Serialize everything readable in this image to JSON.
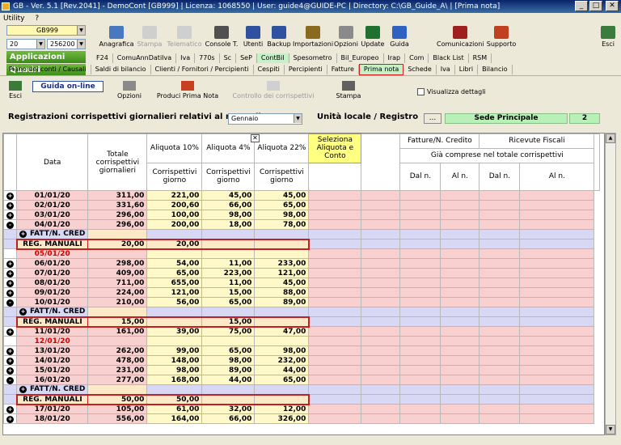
{
  "window": {
    "title": "GB - Ver. 5.1 [Rev.2041] - DemoCont [GB999]   | Licenza: 1068550 | User: guide4@GUIDE-PC | Directory: C:\\GB_Guide_A\\ | [Prima nota]"
  },
  "menu": [
    "Utility",
    "?"
  ],
  "left": {
    "company": "GB999",
    "year": "20",
    "code": "256200",
    "applicazioni": "Applicazioni",
    "quadri": "Quadri"
  },
  "toolbar": [
    "Anagrafica",
    "Stampa",
    "Telematico",
    "Console T.",
    "Utenti",
    "Backup",
    "Importazioni",
    "Opzioni",
    "Update",
    "Guida",
    "Comunicazioni",
    "Supporto",
    "Esci"
  ],
  "tabs1": [
    "F24",
    "ComuAnnDatiIva",
    "Iva",
    "770s",
    "Sc",
    "SeP",
    "ContBil",
    "Spesometro",
    "Bil_Europeo",
    "Irap",
    "Com",
    "Black List",
    "RSM"
  ],
  "tabs2": [
    "Prima nota",
    "Schede",
    "Iva",
    "Libri",
    "Bilancio"
  ],
  "tabs2_left": [
    "Piano dei conti / Causali",
    "Saldi di bilancio",
    "Clienti / Fornitori / Percipienti",
    "Cespiti",
    "Percipienti",
    "Fatture"
  ],
  "sub": {
    "esci": "Esci",
    "guida": "Guida on-line",
    "opzioni": "Opzioni",
    "produci": "Produci Prima Nota",
    "controllo": "Controllo dei corrispettivi",
    "stampa": "Stampa",
    "visualizza": "Visualizza dettagli"
  },
  "form": {
    "title": "Registrazioni corrispettivi giornalieri relativi al mese di",
    "mese": "Gennaio",
    "unita": "Unità locale / Registro",
    "dots": "...",
    "sede": "Sede Principale",
    "num": "2"
  },
  "headers": {
    "data": "Data",
    "totale": "Totale corrispettivi giornalieri",
    "a10": "Aliquota 10%",
    "a4": "Aliquota 4%",
    "a22": "Aliquota 22%",
    "seleziona": "Seleziona Aliquota e Conto",
    "corr": "Corrispettivi giorno",
    "fatture": "Fatture/N. Credito",
    "ricevute": "Ricevute Fiscali",
    "gia": "Già comprese nel totale corrispettivi",
    "dal": "Dal n.",
    "al": "Al n.",
    "x": "✕"
  },
  "rows": [
    {
      "t": "d",
      "icon": "+",
      "date": "01/01/20",
      "tot": "311,00",
      "a": "221,00",
      "b": "45,00",
      "c": "45,00"
    },
    {
      "t": "d",
      "icon": "+",
      "date": "02/01/20",
      "tot": "331,60",
      "a": "200,60",
      "b": "66,00",
      "c": "65,00"
    },
    {
      "t": "d",
      "icon": "+",
      "date": "03/01/20",
      "tot": "296,00",
      "a": "100,00",
      "b": "98,00",
      "c": "98,00"
    },
    {
      "t": "d",
      "icon": "-",
      "date": "04/01/20",
      "tot": "296,00",
      "a": "200,00",
      "b": "18,00",
      "c": "78,00"
    },
    {
      "t": "f",
      "label": "FATT/N. CRED"
    },
    {
      "t": "r",
      "label": "REG. MANUALI",
      "tot": "20,00",
      "a": "20,00",
      "b": "",
      "c": ""
    },
    {
      "t": "e",
      "date": "05/01/20"
    },
    {
      "t": "d",
      "icon": "+",
      "date": "06/01/20",
      "tot": "298,00",
      "a": "54,00",
      "b": "11,00",
      "c": "233,00"
    },
    {
      "t": "d",
      "icon": "+",
      "date": "07/01/20",
      "tot": "409,00",
      "a": "65,00",
      "b": "223,00",
      "c": "121,00"
    },
    {
      "t": "d",
      "icon": "+",
      "date": "08/01/20",
      "tot": "711,00",
      "a": "655,00",
      "b": "11,00",
      "c": "45,00"
    },
    {
      "t": "d",
      "icon": "+",
      "date": "09/01/20",
      "tot": "224,00",
      "a": "121,00",
      "b": "15,00",
      "c": "88,00"
    },
    {
      "t": "d",
      "icon": "-",
      "date": "10/01/20",
      "tot": "210,00",
      "a": "56,00",
      "b": "65,00",
      "c": "89,00"
    },
    {
      "t": "f",
      "label": "FATT/N. CRED"
    },
    {
      "t": "r",
      "label": "REG. MANUALI",
      "tot": "15,00",
      "a": "",
      "b": "15,00",
      "c": ""
    },
    {
      "t": "d",
      "icon": "+",
      "date": "11/01/20",
      "tot": "161,00",
      "a": "39,00",
      "b": "75,00",
      "c": "47,00"
    },
    {
      "t": "e",
      "date": "12/01/20"
    },
    {
      "t": "d",
      "icon": "+",
      "date": "13/01/20",
      "tot": "262,00",
      "a": "99,00",
      "b": "65,00",
      "c": "98,00"
    },
    {
      "t": "d",
      "icon": "+",
      "date": "14/01/20",
      "tot": "478,00",
      "a": "148,00",
      "b": "98,00",
      "c": "232,00"
    },
    {
      "t": "d",
      "icon": "+",
      "date": "15/01/20",
      "tot": "231,00",
      "a": "98,00",
      "b": "89,00",
      "c": "44,00"
    },
    {
      "t": "d",
      "icon": "-",
      "date": "16/01/20",
      "tot": "277,00",
      "a": "168,00",
      "b": "44,00",
      "c": "65,00"
    },
    {
      "t": "f",
      "label": "FATT/N. CRED"
    },
    {
      "t": "r",
      "label": "REG. MANUALI",
      "tot": "50,00",
      "a": "50,00",
      "b": "",
      "c": ""
    },
    {
      "t": "d",
      "icon": "+",
      "date": "17/01/20",
      "tot": "105,00",
      "a": "61,00",
      "b": "32,00",
      "c": "12,00"
    },
    {
      "t": "d",
      "icon": "+",
      "date": "18/01/20",
      "tot": "556,00",
      "a": "164,00",
      "b": "66,00",
      "c": "326,00"
    }
  ]
}
